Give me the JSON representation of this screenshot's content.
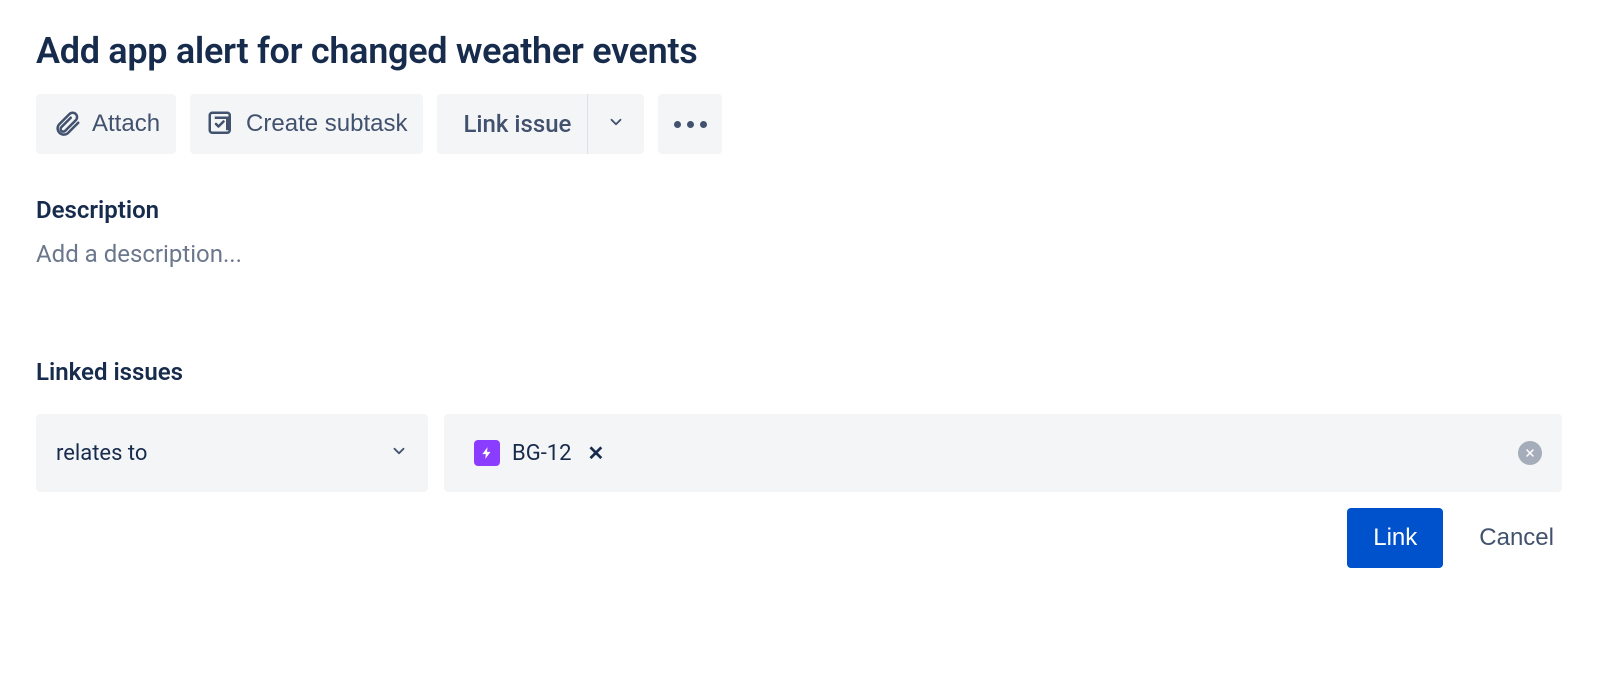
{
  "issue": {
    "title": "Add app alert for changed weather events"
  },
  "actions": {
    "attach": "Attach",
    "create_subtask": "Create subtask",
    "link_issue": "Link issue"
  },
  "description": {
    "label": "Description",
    "placeholder": "Add a description..."
  },
  "linked_issues": {
    "label": "Linked issues",
    "relationship": "relates to",
    "selected": {
      "key": "BG-12"
    }
  },
  "buttons": {
    "link": "Link",
    "cancel": "Cancel"
  }
}
